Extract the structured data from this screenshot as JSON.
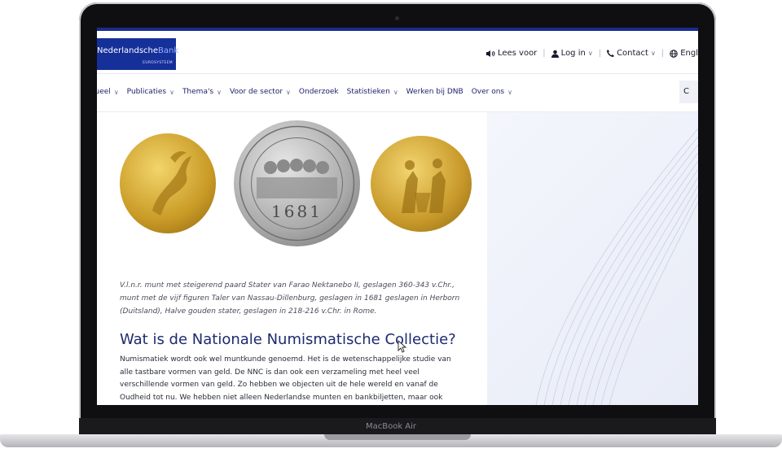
{
  "device": {
    "model_label": "MacBook Air"
  },
  "site": {
    "logo": {
      "name_part1": "Nederlandsche",
      "name_part2": "Bank",
      "subtitle": "EUROSYSTEEM"
    },
    "utility": [
      {
        "label": "Lees voor",
        "icon": "speaker-icon"
      },
      {
        "label": "Log in",
        "icon": "user-icon"
      },
      {
        "label": "Contact",
        "icon": "phone-icon"
      },
      {
        "label": "Engl",
        "icon": "globe-icon"
      }
    ],
    "nav": [
      "tueel",
      "Publicaties",
      "Thema's",
      "Voor de sector",
      "Onderzoek",
      "Statistieken",
      "Werken bij DNB",
      "Over ons"
    ],
    "search_label": "C"
  },
  "content": {
    "coin2_year": "1681",
    "caption": "V.l.n.r. munt met steigerend paard Stater van Farao Nektanebo II, geslagen 360-343 v.Chr., munt met de vijf figuren Taler van Nassau-Dillenburg, geslagen in 1681 geslagen in Herborn (Duitsland), Halve gouden stater, geslagen in 218-216 v.Chr. in Rome.",
    "heading": "Wat is de Nationale Numismatische Collectie?",
    "body": "Numismatiek wordt ook wel muntkunde genoemd. Het is de wetenschappelijke studie van alle tastbare vormen van geld. De NNC is dan ook een verzameling met heel veel verschillende vormen van geld. Zo hebben we objecten uit de hele wereld en vanaf de Oudheid tot nu. We hebben niet alleen Nederlandse munten en bankbiljetten, maar ook Griekse en Romeinse"
  },
  "colors": {
    "brand": "#16309a",
    "topbar": "#1b2b8f",
    "heading": "#1e2a6e"
  }
}
